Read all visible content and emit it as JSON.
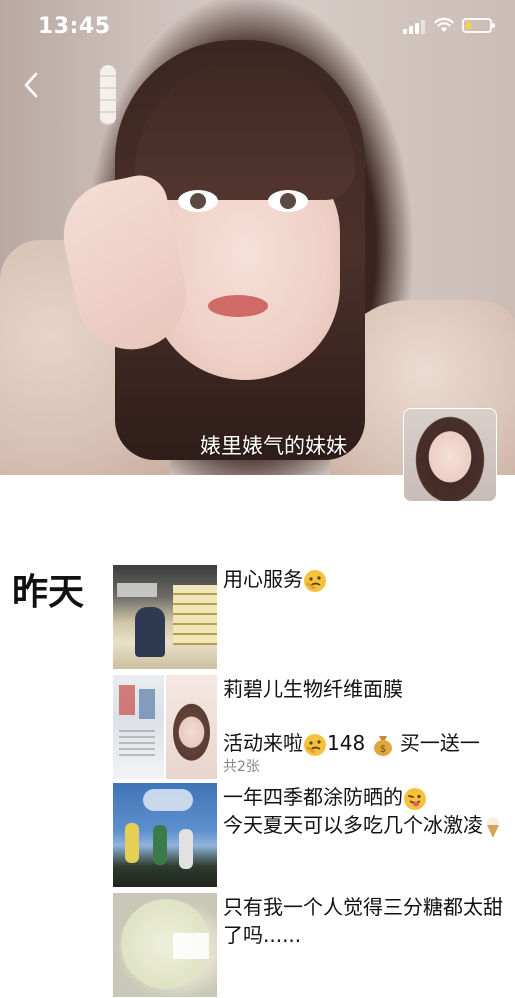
{
  "status_bar": {
    "time": "13:45"
  },
  "profile": {
    "nickname": "婊里婊气的妹妹"
  },
  "feed": {
    "day_label": "昨天",
    "posts": [
      {
        "lines": [
          "用心服务"
        ],
        "emoji": "thinking-face"
      },
      {
        "lines": [
          "莉碧儿生物纤维面膜",
          "活动来啦",
          "148",
          "买一送一"
        ],
        "image_count": "共2张",
        "emoji": [
          "thinking-face",
          "money-bag"
        ]
      },
      {
        "lines": [
          "一年四季都涂防晒的",
          "今天夏天可以多吃几个冰激凌"
        ],
        "emoji": [
          "winking-tongue-face",
          "ice-cream-cone"
        ]
      },
      {
        "lines": [
          "只有我一个人觉得三分糖都太甜了吗......"
        ]
      }
    ]
  },
  "colors": {
    "battery": "#f5d33a",
    "secondary_text": "#888888"
  },
  "icons": [
    "back-chevron-icon",
    "signal-icon",
    "wifi-icon",
    "battery-icon"
  ]
}
